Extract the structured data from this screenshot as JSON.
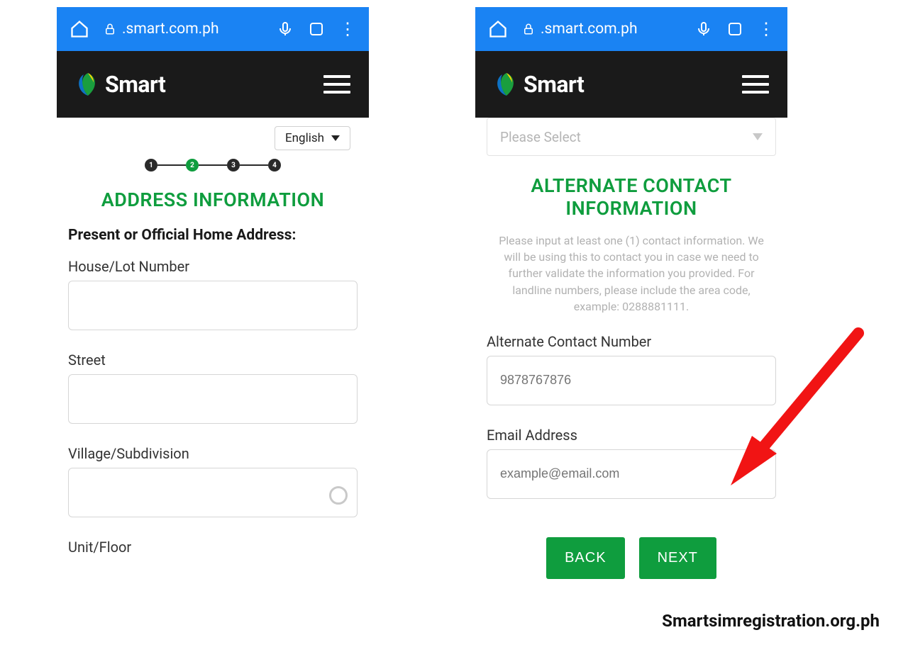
{
  "chrome": {
    "address": ".smart.com.ph"
  },
  "brand": {
    "name": "Smart"
  },
  "left": {
    "language": "English",
    "steps": [
      "1",
      "2",
      "3",
      "4"
    ],
    "active_step_index": 1,
    "section_title": "ADDRESS INFORMATION",
    "subhead": "Present or Official Home Address:",
    "fields": {
      "house": "House/Lot Number",
      "street": "Street",
      "village": "Village/Subdivision",
      "unit": "Unit/Floor"
    }
  },
  "right": {
    "select_placeholder": "Please Select",
    "section_title": "ALTERNATE CONTACT INFORMATION",
    "desc": "Please input at least one (1) contact information. We will be using this to contact you in case we need to further validate the information you provided. For landline numbers, please include the area code, example: 0288881111.",
    "fields": {
      "alt_number_label": "Alternate Contact Number",
      "alt_number_placeholder": "9878767876",
      "email_label": "Email Address",
      "email_placeholder": "example@email.com"
    },
    "buttons": {
      "back": "BACK",
      "next": "NEXT"
    }
  },
  "footer": "Smartsimregistration.org.ph"
}
